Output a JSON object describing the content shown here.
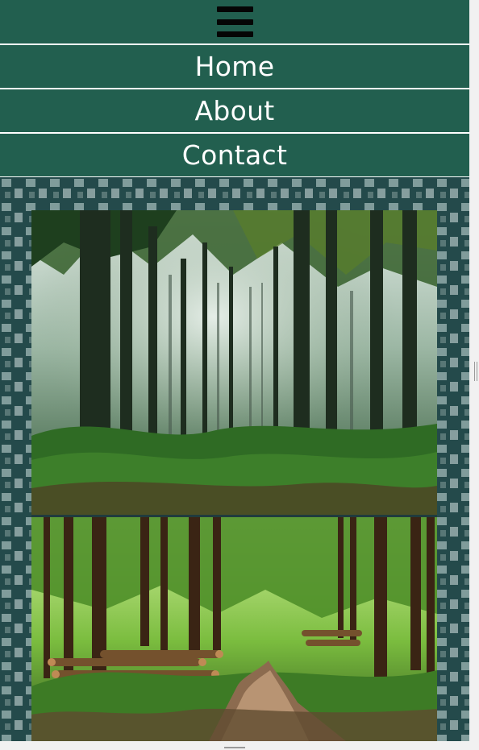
{
  "nav": {
    "menu_icon": "hamburger-menu-icon",
    "items": [
      {
        "label": "Home"
      },
      {
        "label": "About"
      },
      {
        "label": "Contact"
      }
    ]
  },
  "hero": {
    "images": [
      {
        "subject": "misty green forest"
      },
      {
        "subject": "forest path with stacked logs"
      }
    ]
  },
  "colors": {
    "nav_background": "#225f4f",
    "nav_text": "#ffffff",
    "hero_background": "#2e4f4f"
  }
}
